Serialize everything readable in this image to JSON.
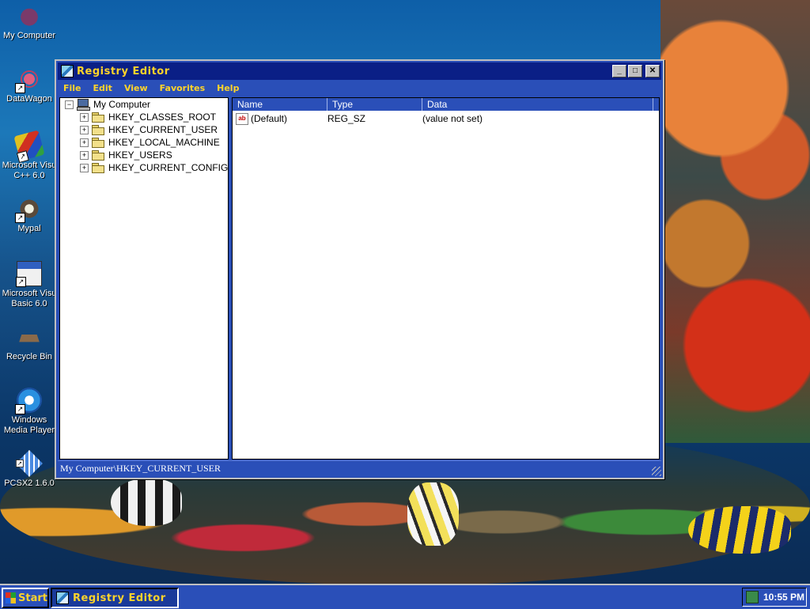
{
  "desktop": {
    "icons": [
      {
        "label": "My Computer",
        "icon": "computer-icon"
      },
      {
        "label": "DataWagon",
        "icon": "datawagon-shortcut-icon"
      },
      {
        "label": "Microsoft Visu C++ 6.0",
        "icon": "visual-cpp-shortcut-icon"
      },
      {
        "label": "Mypal",
        "icon": "mypal-browser-shortcut-icon"
      },
      {
        "label": "Microsoft Visu Basic 6.0",
        "icon": "visual-basic-shortcut-icon"
      },
      {
        "label": "Recycle Bin",
        "icon": "recycle-bin-icon"
      },
      {
        "label": "Windows Media Player",
        "icon": "media-player-shortcut-icon"
      },
      {
        "label": "PCSX2 1.6.0",
        "icon": "pcsx2-shortcut-icon"
      }
    ]
  },
  "window": {
    "title": "Registry Editor",
    "controls": {
      "minimize": "_",
      "maximize": "□",
      "close": "✕"
    },
    "menu": [
      "File",
      "Edit",
      "View",
      "Favorites",
      "Help"
    ],
    "tree": {
      "root": "My Computer",
      "expand_root": "−",
      "expand_child": "+",
      "children": [
        "HKEY_CLASSES_ROOT",
        "HKEY_CURRENT_USER",
        "HKEY_LOCAL_MACHINE",
        "HKEY_USERS",
        "HKEY_CURRENT_CONFIG"
      ]
    },
    "list": {
      "columns": [
        "Name",
        "Type",
        "Data"
      ],
      "rows": [
        {
          "name": "(Default)",
          "type": "REG_SZ",
          "data": "(value not set)",
          "icon_text": "ab"
        }
      ]
    },
    "status": "My Computer\\HKEY_CURRENT_USER"
  },
  "taskbar": {
    "start_label": "Start",
    "task_label": "Registry Editor",
    "clock": "10:55 PM"
  },
  "colors": {
    "window_blue": "#2a4fb8",
    "title_text": "#ffd42a",
    "titlebar": "#0a1f86"
  }
}
